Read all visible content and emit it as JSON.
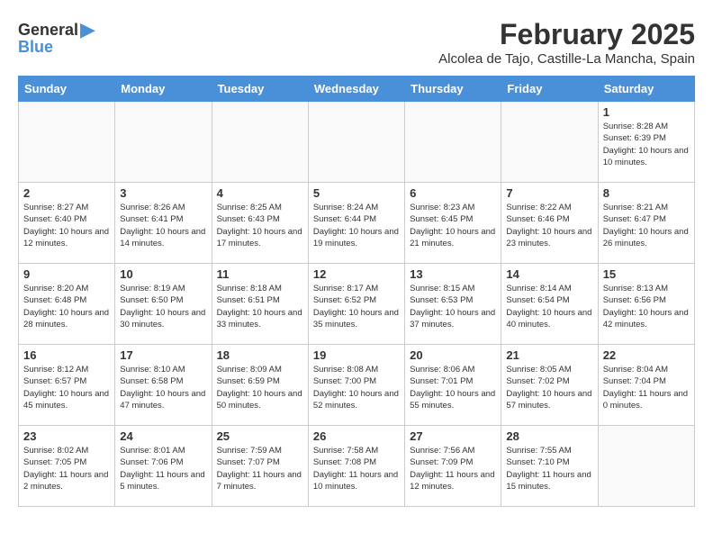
{
  "logo": {
    "general": "General",
    "blue": "Blue"
  },
  "title": "February 2025",
  "subtitle": "Alcolea de Tajo, Castille-La Mancha, Spain",
  "weekdays": [
    "Sunday",
    "Monday",
    "Tuesday",
    "Wednesday",
    "Thursday",
    "Friday",
    "Saturday"
  ],
  "weeks": [
    [
      {
        "day": "",
        "info": ""
      },
      {
        "day": "",
        "info": ""
      },
      {
        "day": "",
        "info": ""
      },
      {
        "day": "",
        "info": ""
      },
      {
        "day": "",
        "info": ""
      },
      {
        "day": "",
        "info": ""
      },
      {
        "day": "1",
        "info": "Sunrise: 8:28 AM\nSunset: 6:39 PM\nDaylight: 10 hours and 10 minutes."
      }
    ],
    [
      {
        "day": "2",
        "info": "Sunrise: 8:27 AM\nSunset: 6:40 PM\nDaylight: 10 hours and 12 minutes."
      },
      {
        "day": "3",
        "info": "Sunrise: 8:26 AM\nSunset: 6:41 PM\nDaylight: 10 hours and 14 minutes."
      },
      {
        "day": "4",
        "info": "Sunrise: 8:25 AM\nSunset: 6:43 PM\nDaylight: 10 hours and 17 minutes."
      },
      {
        "day": "5",
        "info": "Sunrise: 8:24 AM\nSunset: 6:44 PM\nDaylight: 10 hours and 19 minutes."
      },
      {
        "day": "6",
        "info": "Sunrise: 8:23 AM\nSunset: 6:45 PM\nDaylight: 10 hours and 21 minutes."
      },
      {
        "day": "7",
        "info": "Sunrise: 8:22 AM\nSunset: 6:46 PM\nDaylight: 10 hours and 23 minutes."
      },
      {
        "day": "8",
        "info": "Sunrise: 8:21 AM\nSunset: 6:47 PM\nDaylight: 10 hours and 26 minutes."
      }
    ],
    [
      {
        "day": "9",
        "info": "Sunrise: 8:20 AM\nSunset: 6:48 PM\nDaylight: 10 hours and 28 minutes."
      },
      {
        "day": "10",
        "info": "Sunrise: 8:19 AM\nSunset: 6:50 PM\nDaylight: 10 hours and 30 minutes."
      },
      {
        "day": "11",
        "info": "Sunrise: 8:18 AM\nSunset: 6:51 PM\nDaylight: 10 hours and 33 minutes."
      },
      {
        "day": "12",
        "info": "Sunrise: 8:17 AM\nSunset: 6:52 PM\nDaylight: 10 hours and 35 minutes."
      },
      {
        "day": "13",
        "info": "Sunrise: 8:15 AM\nSunset: 6:53 PM\nDaylight: 10 hours and 37 minutes."
      },
      {
        "day": "14",
        "info": "Sunrise: 8:14 AM\nSunset: 6:54 PM\nDaylight: 10 hours and 40 minutes."
      },
      {
        "day": "15",
        "info": "Sunrise: 8:13 AM\nSunset: 6:56 PM\nDaylight: 10 hours and 42 minutes."
      }
    ],
    [
      {
        "day": "16",
        "info": "Sunrise: 8:12 AM\nSunset: 6:57 PM\nDaylight: 10 hours and 45 minutes."
      },
      {
        "day": "17",
        "info": "Sunrise: 8:10 AM\nSunset: 6:58 PM\nDaylight: 10 hours and 47 minutes."
      },
      {
        "day": "18",
        "info": "Sunrise: 8:09 AM\nSunset: 6:59 PM\nDaylight: 10 hours and 50 minutes."
      },
      {
        "day": "19",
        "info": "Sunrise: 8:08 AM\nSunset: 7:00 PM\nDaylight: 10 hours and 52 minutes."
      },
      {
        "day": "20",
        "info": "Sunrise: 8:06 AM\nSunset: 7:01 PM\nDaylight: 10 hours and 55 minutes."
      },
      {
        "day": "21",
        "info": "Sunrise: 8:05 AM\nSunset: 7:02 PM\nDaylight: 10 hours and 57 minutes."
      },
      {
        "day": "22",
        "info": "Sunrise: 8:04 AM\nSunset: 7:04 PM\nDaylight: 11 hours and 0 minutes."
      }
    ],
    [
      {
        "day": "23",
        "info": "Sunrise: 8:02 AM\nSunset: 7:05 PM\nDaylight: 11 hours and 2 minutes."
      },
      {
        "day": "24",
        "info": "Sunrise: 8:01 AM\nSunset: 7:06 PM\nDaylight: 11 hours and 5 minutes."
      },
      {
        "day": "25",
        "info": "Sunrise: 7:59 AM\nSunset: 7:07 PM\nDaylight: 11 hours and 7 minutes."
      },
      {
        "day": "26",
        "info": "Sunrise: 7:58 AM\nSunset: 7:08 PM\nDaylight: 11 hours and 10 minutes."
      },
      {
        "day": "27",
        "info": "Sunrise: 7:56 AM\nSunset: 7:09 PM\nDaylight: 11 hours and 12 minutes."
      },
      {
        "day": "28",
        "info": "Sunrise: 7:55 AM\nSunset: 7:10 PM\nDaylight: 11 hours and 15 minutes."
      },
      {
        "day": "",
        "info": ""
      }
    ]
  ]
}
